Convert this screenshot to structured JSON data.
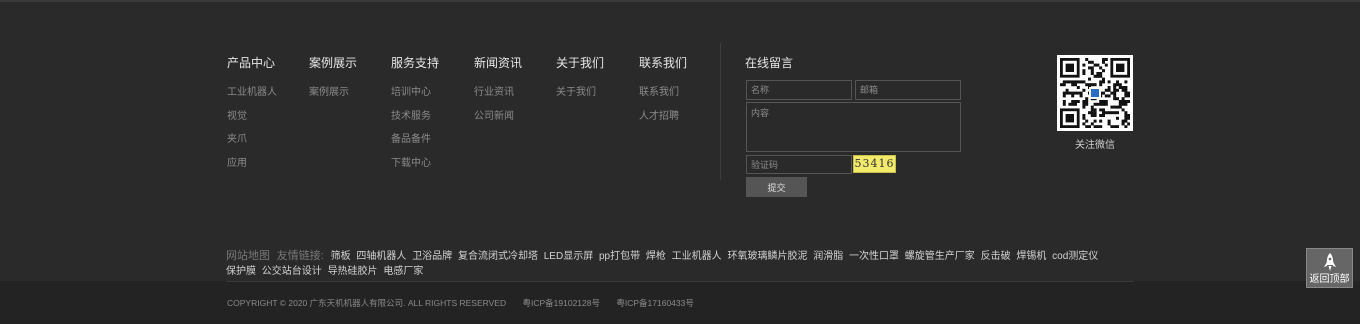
{
  "nav_columns": [
    {
      "title": "产品中心",
      "links": [
        "工业机器人",
        "视觉",
        "夹爪",
        "应用"
      ]
    },
    {
      "title": "案例展示",
      "links": [
        "案例展示"
      ]
    },
    {
      "title": "服务支持",
      "links": [
        "培训中心",
        "技术服务",
        "备品备件",
        "下载中心"
      ]
    },
    {
      "title": "新闻资讯",
      "links": [
        "行业资讯",
        "公司新闻"
      ]
    },
    {
      "title": "关于我们",
      "links": [
        "关于我们"
      ]
    },
    {
      "title": "联系我们",
      "links": [
        "联系我们",
        "人才招聘"
      ]
    }
  ],
  "message_form": {
    "title": "在线留言",
    "name_placeholder": "名称",
    "email_placeholder": "邮箱",
    "content_placeholder": "内容",
    "captcha_placeholder": "验证码",
    "captcha_code": "53416",
    "submit_label": "提交"
  },
  "qr": {
    "label": "关注微信"
  },
  "links": {
    "sitemap_label": "网站地图",
    "friend_label": "友情链接:",
    "items": [
      "筛板",
      "四轴机器人",
      "卫浴品牌",
      "复合流闭式冷却塔",
      "LED显示屏",
      "pp打包带",
      "焊枪",
      "工业机器人",
      "环氧玻璃鳞片胶泥",
      "润滑脂",
      "一次性口罩",
      "螺旋管生产厂家",
      "反击破",
      "焊锡机",
      "cod测定仪",
      "保护膜",
      "公交站台设计",
      "导热硅胶片",
      "电感厂家"
    ]
  },
  "footer": {
    "copyright": "COPYRIGHT © 2020 广东天机机器人有限公司. ALL RIGHTS RESERVED",
    "icp1": "粤ICP备19102128号",
    "icp2": "粤ICP备17160433号"
  },
  "back_to_top": {
    "label": "返回顶部",
    "icon": "rocket-icon"
  }
}
